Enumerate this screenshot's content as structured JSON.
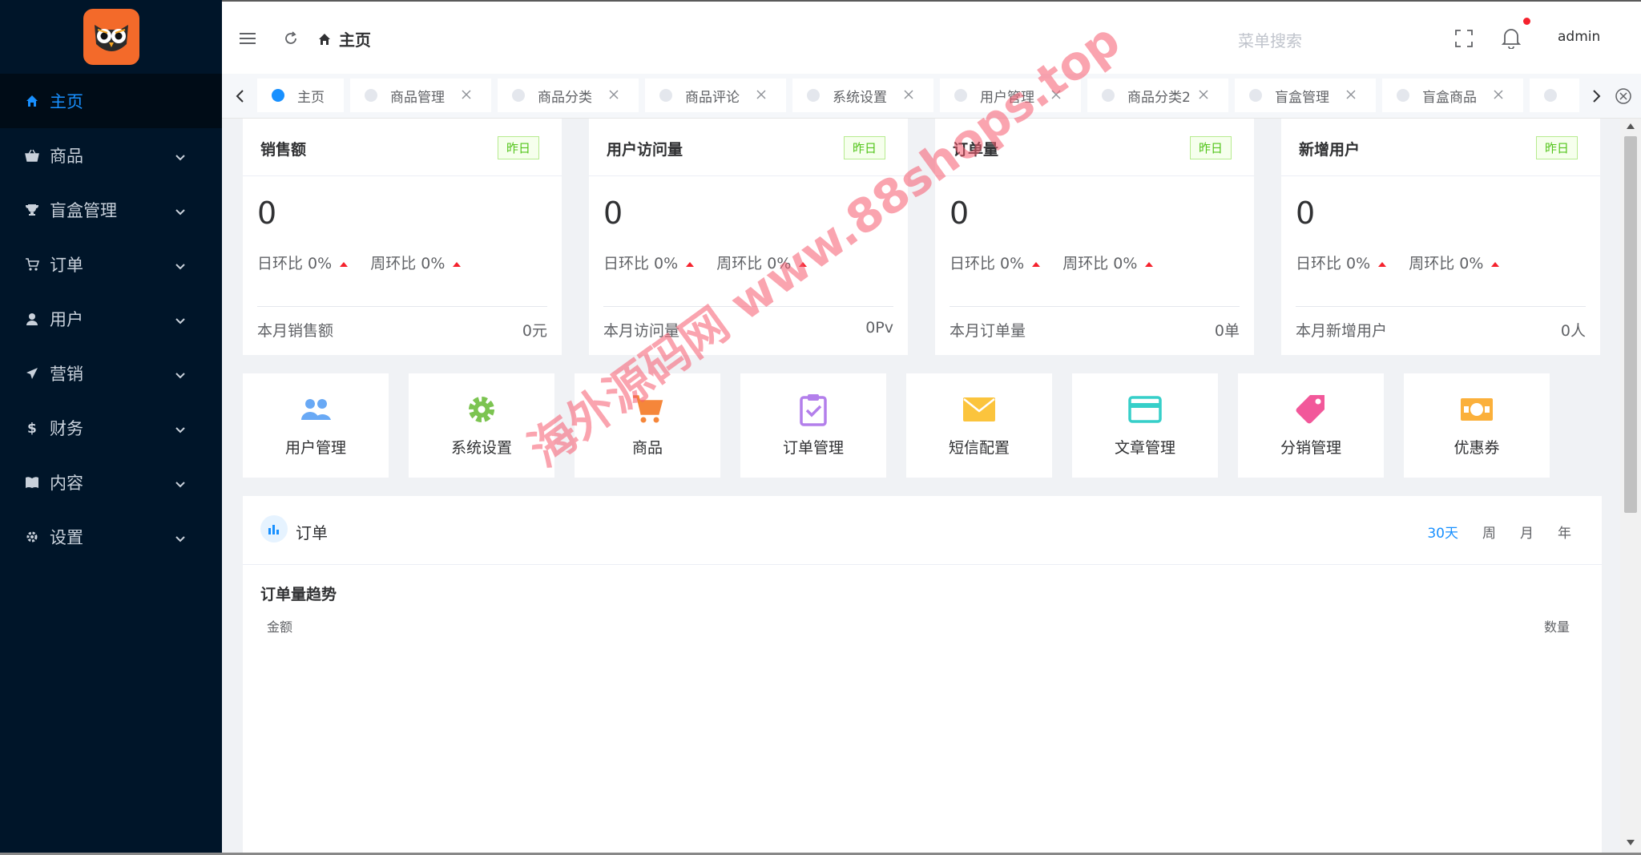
{
  "sidebar": {
    "items": [
      {
        "label": "主页",
        "icon": "home-icon",
        "active": true
      },
      {
        "label": "商品",
        "icon": "basket-icon"
      },
      {
        "label": "盲盒管理",
        "icon": "trophy-icon"
      },
      {
        "label": "订单",
        "icon": "cart-icon"
      },
      {
        "label": "用户",
        "icon": "user-icon"
      },
      {
        "label": "营销",
        "icon": "send-icon"
      },
      {
        "label": "财务",
        "icon": "dollar-icon"
      },
      {
        "label": "内容",
        "icon": "book-icon"
      },
      {
        "label": "设置",
        "icon": "gear-icon"
      }
    ]
  },
  "header": {
    "breadcrumb": "主页",
    "search_placeholder": "菜单搜索",
    "user": "admin"
  },
  "tabs": [
    "主页",
    "商品管理",
    "商品分类",
    "商品评论",
    "系统设置",
    "用户管理",
    "商品分类2",
    "盲盒管理",
    "盲盒商品"
  ],
  "stats": [
    {
      "title": "销售额",
      "badge": "昨日",
      "value": "0",
      "day_ratio": "日环比 0%",
      "week_ratio": "周环比 0%",
      "foot_label": "本月销售额",
      "foot_value": "0元"
    },
    {
      "title": "用户访问量",
      "badge": "昨日",
      "value": "0",
      "day_ratio": "日环比 0%",
      "week_ratio": "周环比 0%",
      "foot_label": "本月访问量",
      "foot_value": "0Pv"
    },
    {
      "title": "订单量",
      "badge": "昨日",
      "value": "0",
      "day_ratio": "日环比 0%",
      "week_ratio": "周环比 0%",
      "foot_label": "本月订单量",
      "foot_value": "0单"
    },
    {
      "title": "新增用户",
      "badge": "昨日",
      "value": "0",
      "day_ratio": "日环比 0%",
      "week_ratio": "周环比 0%",
      "foot_label": "本月新增用户",
      "foot_value": "0人"
    }
  ],
  "shortcuts": [
    {
      "label": "用户管理",
      "icon": "users-icon",
      "color": "#69a9f5"
    },
    {
      "label": "系统设置",
      "icon": "gear-icon",
      "color": "#7cc451"
    },
    {
      "label": "商品",
      "icon": "shopping-cart-icon",
      "color": "#f5863a"
    },
    {
      "label": "订单管理",
      "icon": "clipboard-icon",
      "color": "#b37feb"
    },
    {
      "label": "短信配置",
      "icon": "mail-icon",
      "color": "#fbc43d"
    },
    {
      "label": "文章管理",
      "icon": "card-icon",
      "color": "#36cfc9"
    },
    {
      "label": "分销管理",
      "icon": "tag-icon",
      "color": "#f2589a"
    },
    {
      "label": "优惠券",
      "icon": "money-icon",
      "color": "#fbb03b"
    }
  ],
  "order_panel": {
    "title": "订单",
    "periods": [
      "30天",
      "周",
      "月",
      "年"
    ],
    "active_period": "30天",
    "chart_title": "订单量趋势",
    "left_axis": "金额",
    "right_axis": "数量"
  },
  "watermark": "海外源码网 www.88shops.top",
  "colors": {
    "sidebar_bg": "#001529",
    "accent": "#1890ff",
    "badge_green": "#52c41a",
    "up_red": "#f5222d"
  }
}
